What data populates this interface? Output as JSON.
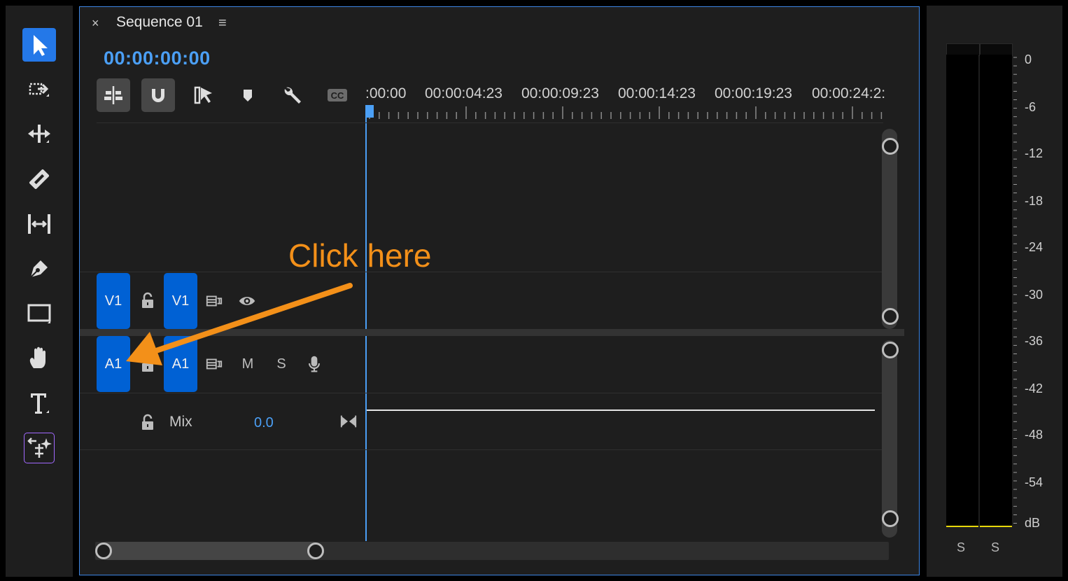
{
  "tools": [
    {
      "name": "selection-tool",
      "icon": "arrow-select-icon",
      "active": true
    },
    {
      "name": "track-select-tool",
      "icon": "track-select-forward-icon"
    },
    {
      "name": "ripple-edit-tool",
      "icon": "ripple-edit-icon"
    },
    {
      "name": "razor-tool",
      "icon": "razor-icon"
    },
    {
      "name": "slip-tool",
      "icon": "slip-icon"
    },
    {
      "name": "pen-tool",
      "icon": "pen-icon"
    },
    {
      "name": "rectangle-tool",
      "icon": "rectangle-icon"
    },
    {
      "name": "hand-tool",
      "icon": "hand-icon"
    },
    {
      "name": "type-tool",
      "icon": "type-icon"
    },
    {
      "name": "generative-extend-tool",
      "icon": "generative-extend-icon",
      "highlight_color": "#a269ff"
    }
  ],
  "sequence": {
    "close_glyph": "×",
    "title": "Sequence 01",
    "menu_glyph": "≡",
    "timecode": "00:00:00:00"
  },
  "timeline_toolbar": [
    {
      "name": "nest-insert-button",
      "icon": "nest-sequence-icon",
      "on": true
    },
    {
      "name": "snap-button",
      "icon": "magnet-icon",
      "on": true
    },
    {
      "name": "linked-selection-button",
      "icon": "linked-selection-icon",
      "on": false
    },
    {
      "name": "add-marker-button",
      "icon": "marker-icon",
      "on": false
    },
    {
      "name": "timeline-settings-button",
      "icon": "wrench-icon",
      "on": false
    },
    {
      "name": "captions-button",
      "icon": "cc-icon",
      "on": false
    }
  ],
  "ruler": {
    "labels": [
      ":00:00",
      "00:00:04:23",
      "00:00:09:23",
      "00:00:14:23",
      "00:00:19:23",
      "00:00:24:2:"
    ]
  },
  "tracks": {
    "v1": {
      "source_label": "V1",
      "target_label": "V1"
    },
    "a1": {
      "source_label": "A1",
      "target_label": "A1",
      "mute_label": "M",
      "solo_label": "S"
    },
    "mix": {
      "label": "Mix",
      "value": "0.0"
    }
  },
  "annotation": {
    "text": "Click here",
    "color": "#f39019"
  },
  "meters": {
    "db_scale": [
      "0",
      "-6",
      "-12",
      "-18",
      "-24",
      "-30",
      "-36",
      "-42",
      "-48",
      "-54",
      "dB"
    ],
    "solo_labels": [
      "S",
      "S"
    ],
    "level_color": "#e8d80a"
  },
  "colors": {
    "accent": "#4b9ff5",
    "track_blue": "#0061d4",
    "panel_border": "#3d86e4"
  }
}
